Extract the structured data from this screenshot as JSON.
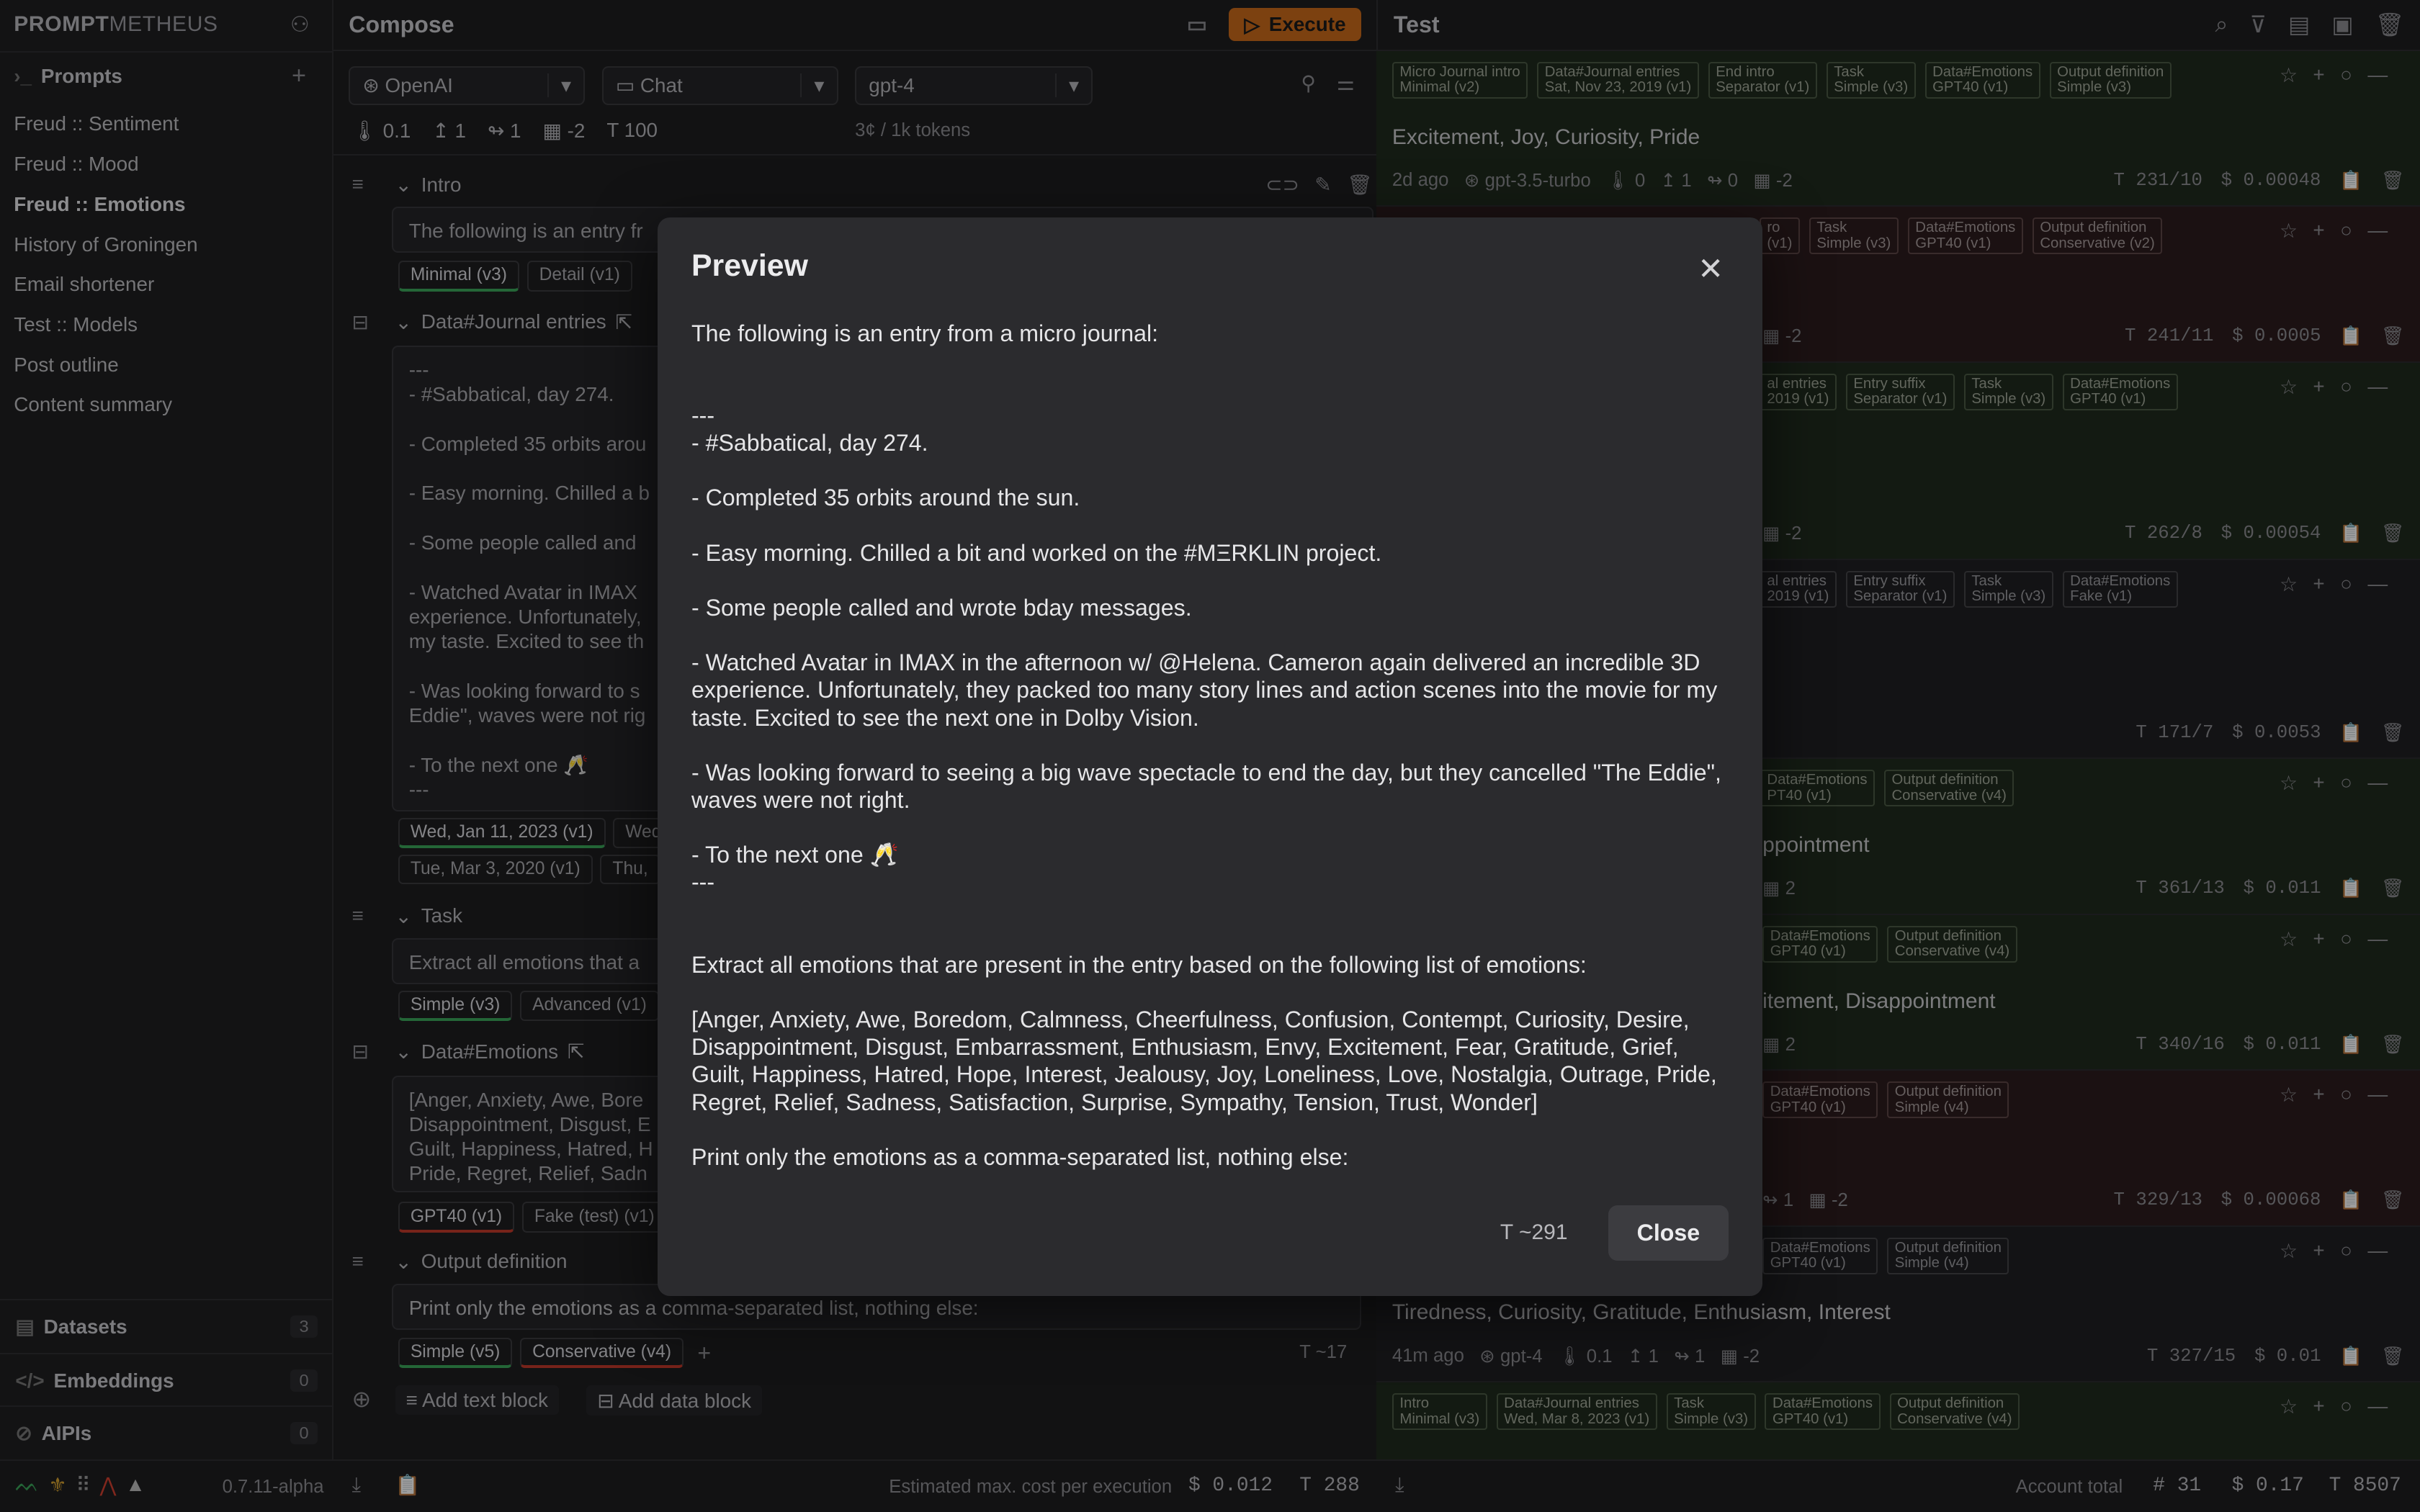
{
  "app": {
    "logo_bold": "PROMPT",
    "logo_rest": "METHEUS",
    "version": "0.7.11-alpha"
  },
  "sidebar": {
    "prompts_label": "Prompts",
    "items": [
      {
        "label": "Freud :: Sentiment"
      },
      {
        "label": "Freud :: Mood"
      },
      {
        "label": "Freud :: Emotions"
      },
      {
        "label": "History of Groningen"
      },
      {
        "label": "Email shortener"
      },
      {
        "label": "Test :: Models"
      },
      {
        "label": "Post outline"
      },
      {
        "label": "Content summary"
      }
    ],
    "sections": [
      {
        "label": "Datasets",
        "count": "3"
      },
      {
        "label": "Embeddings",
        "count": "0"
      },
      {
        "label": "AIPIs",
        "count": "0"
      }
    ]
  },
  "compose": {
    "title": "Compose",
    "execute_label": "Execute",
    "provider": "OpenAI",
    "mode": "Chat",
    "model": "gpt-4",
    "params": {
      "temperature": "0.1",
      "top_p": "1",
      "freq": "1",
      "presence": "-2",
      "max_tokens": "100"
    },
    "price": "3¢ / 1k tokens",
    "blocks": {
      "intro": {
        "title": "Intro",
        "text": "The following is an entry fr",
        "tags": [
          "Minimal (v3)",
          "Detail (v1)"
        ]
      },
      "journal": {
        "title": "Data#Journal entries",
        "lines": [
          "---",
          "- #Sabbatical, day 274.",
          "",
          "- Completed 35 orbits arou",
          "",
          "- Easy morning. Chilled a b",
          "",
          "- Some people called and",
          "",
          "- Watched Avatar in IMAX",
          "experience. Unfortunately,",
          "my taste. Excited to see th",
          "",
          "- Was looking forward to s",
          "Eddie\", waves were not rig",
          "",
          "- To the next one 🥂",
          "---"
        ],
        "tags_row1": [
          "Wed, Jan 11, 2023 (v1)",
          "Wed"
        ],
        "tags_row2": [
          "Tue, Mar 3, 2020 (v1)",
          "Thu,"
        ]
      },
      "task": {
        "title": "Task",
        "text": "Extract all emotions that a",
        "tags": [
          "Simple (v3)",
          "Advanced (v1)"
        ]
      },
      "emotions": {
        "title": "Data#Emotions",
        "lines": [
          "[Anger, Anxiety, Awe, Bore",
          "Disappointment, Disgust, E",
          "Guilt, Happiness, Hatred, H",
          "Pride, Regret, Relief, Sadn"
        ],
        "tags": [
          "GPT40 (v1)",
          "Fake (test) (v1)"
        ]
      },
      "output": {
        "title": "Output definition",
        "text": "Print only the emotions as a comma-separated list, nothing else:",
        "tags": [
          "Simple (v5)",
          "Conservative (v4)"
        ],
        "tokens": "~17"
      }
    },
    "add_text": "Add text block",
    "add_data": "Add data block"
  },
  "test": {
    "title": "Test",
    "rows": [
      {
        "chips": [
          "Micro Journal intro|Minimal (v2)",
          "Data#Journal entries|Sat, Nov 23, 2019 (v1)",
          "End intro|Separator (v1)",
          "Task|Simple (v3)",
          "Data#Emotions|GPT40 (v1)",
          "Output definition|Simple (v3)"
        ],
        "result": "Excitement, Joy, Curiosity, Pride",
        "age": "2d ago",
        "model": "gpt-3.5-turbo",
        "p1": "0",
        "p2": "1",
        "p3": "0",
        "p4": "-2",
        "tokens": "231/10",
        "cost": "0.00048"
      },
      {
        "chips": [
          "ro|(v1)",
          "Task|Simple (v3)",
          "Data#Emotions|GPT40 (v1)",
          "Output definition|Conservative (v2)"
        ],
        "p4": "-2",
        "tokens": "241/11",
        "cost": "0.0005"
      },
      {
        "chips": [
          "al entries|2019 (v1)",
          "Entry suffix|Separator (v1)",
          "Task|Simple (v3)",
          "Data#Emotions|GPT40 (v1)"
        ],
        "p4": "-2",
        "tokens": "262/8",
        "cost": "0.00054"
      },
      {
        "chips": [
          "al entries|2019 (v1)",
          "Entry suffix|Separator (v1)",
          "Task|Simple (v3)",
          "Data#Emotions|Fake (v1)"
        ],
        "tokens": "171/7",
        "cost": "0.0053"
      },
      {
        "chips": [
          "Data#Emotions|PT40 (v1)",
          "Output definition|Conservative (v4)"
        ],
        "result": "ppointment",
        "p4": "2",
        "tokens": "361/13",
        "cost": "0.011"
      },
      {
        "chips": [
          "Data#Emotions|GPT40 (v1)",
          "Output definition|Conservative (v4)"
        ],
        "result": "itement, Disappointment",
        "p4": "2",
        "tokens": "340/16",
        "cost": "0.011"
      },
      {
        "chips": [
          "Data#Emotions|GPT40 (v1)",
          "Output definition|Simple (v4)"
        ],
        "p3": "1",
        "p4": "-2",
        "tokens": "329/13",
        "cost": "0.00068"
      },
      {
        "chips": [
          "Data#Emotions|GPT40 (v1)",
          "Output definition|Simple (v4)"
        ],
        "result": "Tiredness, Curiosity, Gratitude, Enthusiasm, Interest",
        "age": "41m ago",
        "model": "gpt-4",
        "p1": "0.1",
        "p2": "1",
        "p3": "1",
        "p4": "-2",
        "tokens": "327/15",
        "cost": "0.01"
      },
      {
        "chips": [
          "Intro|Minimal (v3)",
          "Data#Journal entries|Wed, Mar 8, 2023 (v1)",
          "Task|Simple (v3)",
          "Data#Emotions|GPT40 (v1)",
          "Output definition|Conservative (v4)"
        ]
      }
    ]
  },
  "footer": {
    "estimated_label": "Estimated max. cost per execution",
    "est_cost": "0.012",
    "est_tokens": "288",
    "account_label": "Account total",
    "count": "31",
    "cost": "0.17",
    "tokens": "8507"
  },
  "modal": {
    "title": "Preview",
    "paragraphs": [
      "The following is an entry from a micro journal:",
      "",
      "",
      "---",
      "- #Sabbatical, day 274.",
      "",
      "- Completed 35 orbits around the sun.",
      "",
      "- Easy morning. Chilled a bit and worked on the #MΞRKLIN project.",
      "",
      "- Some people called and wrote bday messages.",
      "",
      "- Watched Avatar in IMAX in the afternoon w/ @Helena. Cameron again delivered an incredible 3D experience. Unfortunately, they packed too many story lines and action scenes into the movie for my taste. Excited to see the next one in Dolby Vision.",
      "",
      "- Was looking forward to seeing a big wave spectacle to end the day, but they cancelled \"The Eddie\", waves were not right.",
      "",
      "- To the next one 🥂",
      "---",
      "",
      "",
      "Extract all emotions that are present in the entry based on the following list of emotions:",
      "",
      "[Anger, Anxiety, Awe, Boredom, Calmness, Cheerfulness, Confusion, Contempt, Curiosity, Desire, Disappointment, Disgust, Embarrassment, Enthusiasm, Envy, Excitement, Fear, Gratitude, Grief, Guilt, Happiness, Hatred, Hope, Interest, Jealousy, Joy, Loneliness, Love, Nostalgia, Outrage, Pride, Regret, Relief, Sadness, Satisfaction, Surprise, Sympathy, Tension, Trust, Wonder]",
      "",
      "Print only the emotions as a comma-separated list, nothing else:"
    ],
    "tokens": "~291",
    "close_label": "Close"
  },
  "colors": {
    "accent": "#c86a1a",
    "row_green": "#1f2b1d",
    "row_red": "#2d1c1d"
  }
}
